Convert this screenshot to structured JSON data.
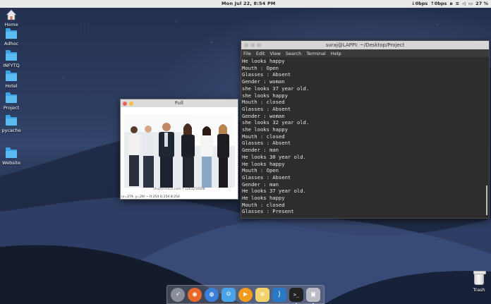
{
  "menubar": {
    "clock": "Mon Jul 22,   8:54 PM",
    "net_down": "↓0bps",
    "net_up": "↑0bps",
    "battery": "27 %"
  },
  "desktop": {
    "icons": [
      {
        "label": "Home",
        "icon": "home-icon"
      },
      {
        "label": "Adhoc",
        "icon": "folder-icon"
      },
      {
        "label": "INFYTQ",
        "icon": "folder-icon"
      },
      {
        "label": "Hotel",
        "icon": "folder-icon"
      },
      {
        "label": "Project",
        "icon": "folder-icon"
      },
      {
        "label": "pycache",
        "icon": "folder-icon"
      },
      {
        "label": "Website",
        "icon": "folder-icon"
      }
    ],
    "trash_label": "Trash"
  },
  "terminal": {
    "title": "suraj@LAPPI: ~/Desktop/Project",
    "menu": [
      "File",
      "Edit",
      "View",
      "Search",
      "Terminal",
      "Help"
    ],
    "lines": [
      "He looks happy",
      "Mouth : Open",
      "Glasses : Absent",
      "Gender : woman",
      "she looks 37 year old.",
      "she looks happy",
      "Mouth : closed",
      "Glasses : Absent",
      "Gender : woman",
      "she looks 32 year old.",
      "she looks happy",
      "Mouth : closed",
      "Glasses : Absent",
      "Gender : man",
      "He looks 30 year old.",
      "He looks happy",
      "Mouth : Open",
      "Glasses : Absent",
      "Gender : man",
      "He looks 37 year old.",
      "He looks happy",
      "Mouth : closed",
      "Glasses : Present"
    ]
  },
  "viewer": {
    "title": "Full",
    "watermark": "shutterstock.com • 1261256608",
    "readout": "(x=279, y=29) ~ R:254 G:254 B:254"
  },
  "dock": {
    "apps": [
      {
        "name": "launchpad",
        "icon": "rocket-icon",
        "color": "#8a8f99"
      },
      {
        "name": "firefox",
        "icon": "firefox-icon",
        "color": "#e8692a"
      },
      {
        "name": "browser",
        "icon": "globe-icon",
        "color": "#3b7fd8"
      },
      {
        "name": "finder",
        "icon": "finder-icon",
        "color": "#4aa3e8"
      },
      {
        "name": "media-player",
        "icon": "play-icon",
        "color": "#f39b1a"
      },
      {
        "name": "notes",
        "icon": "notes-icon",
        "color": "#f2d36b"
      },
      {
        "name": "vscode",
        "icon": "vscode-icon",
        "color": "#2a79c5"
      },
      {
        "name": "terminal",
        "icon": "terminal-icon",
        "color": "#222222"
      },
      {
        "name": "image-viewer",
        "icon": "image-icon",
        "color": "#b9bcc2"
      }
    ]
  }
}
